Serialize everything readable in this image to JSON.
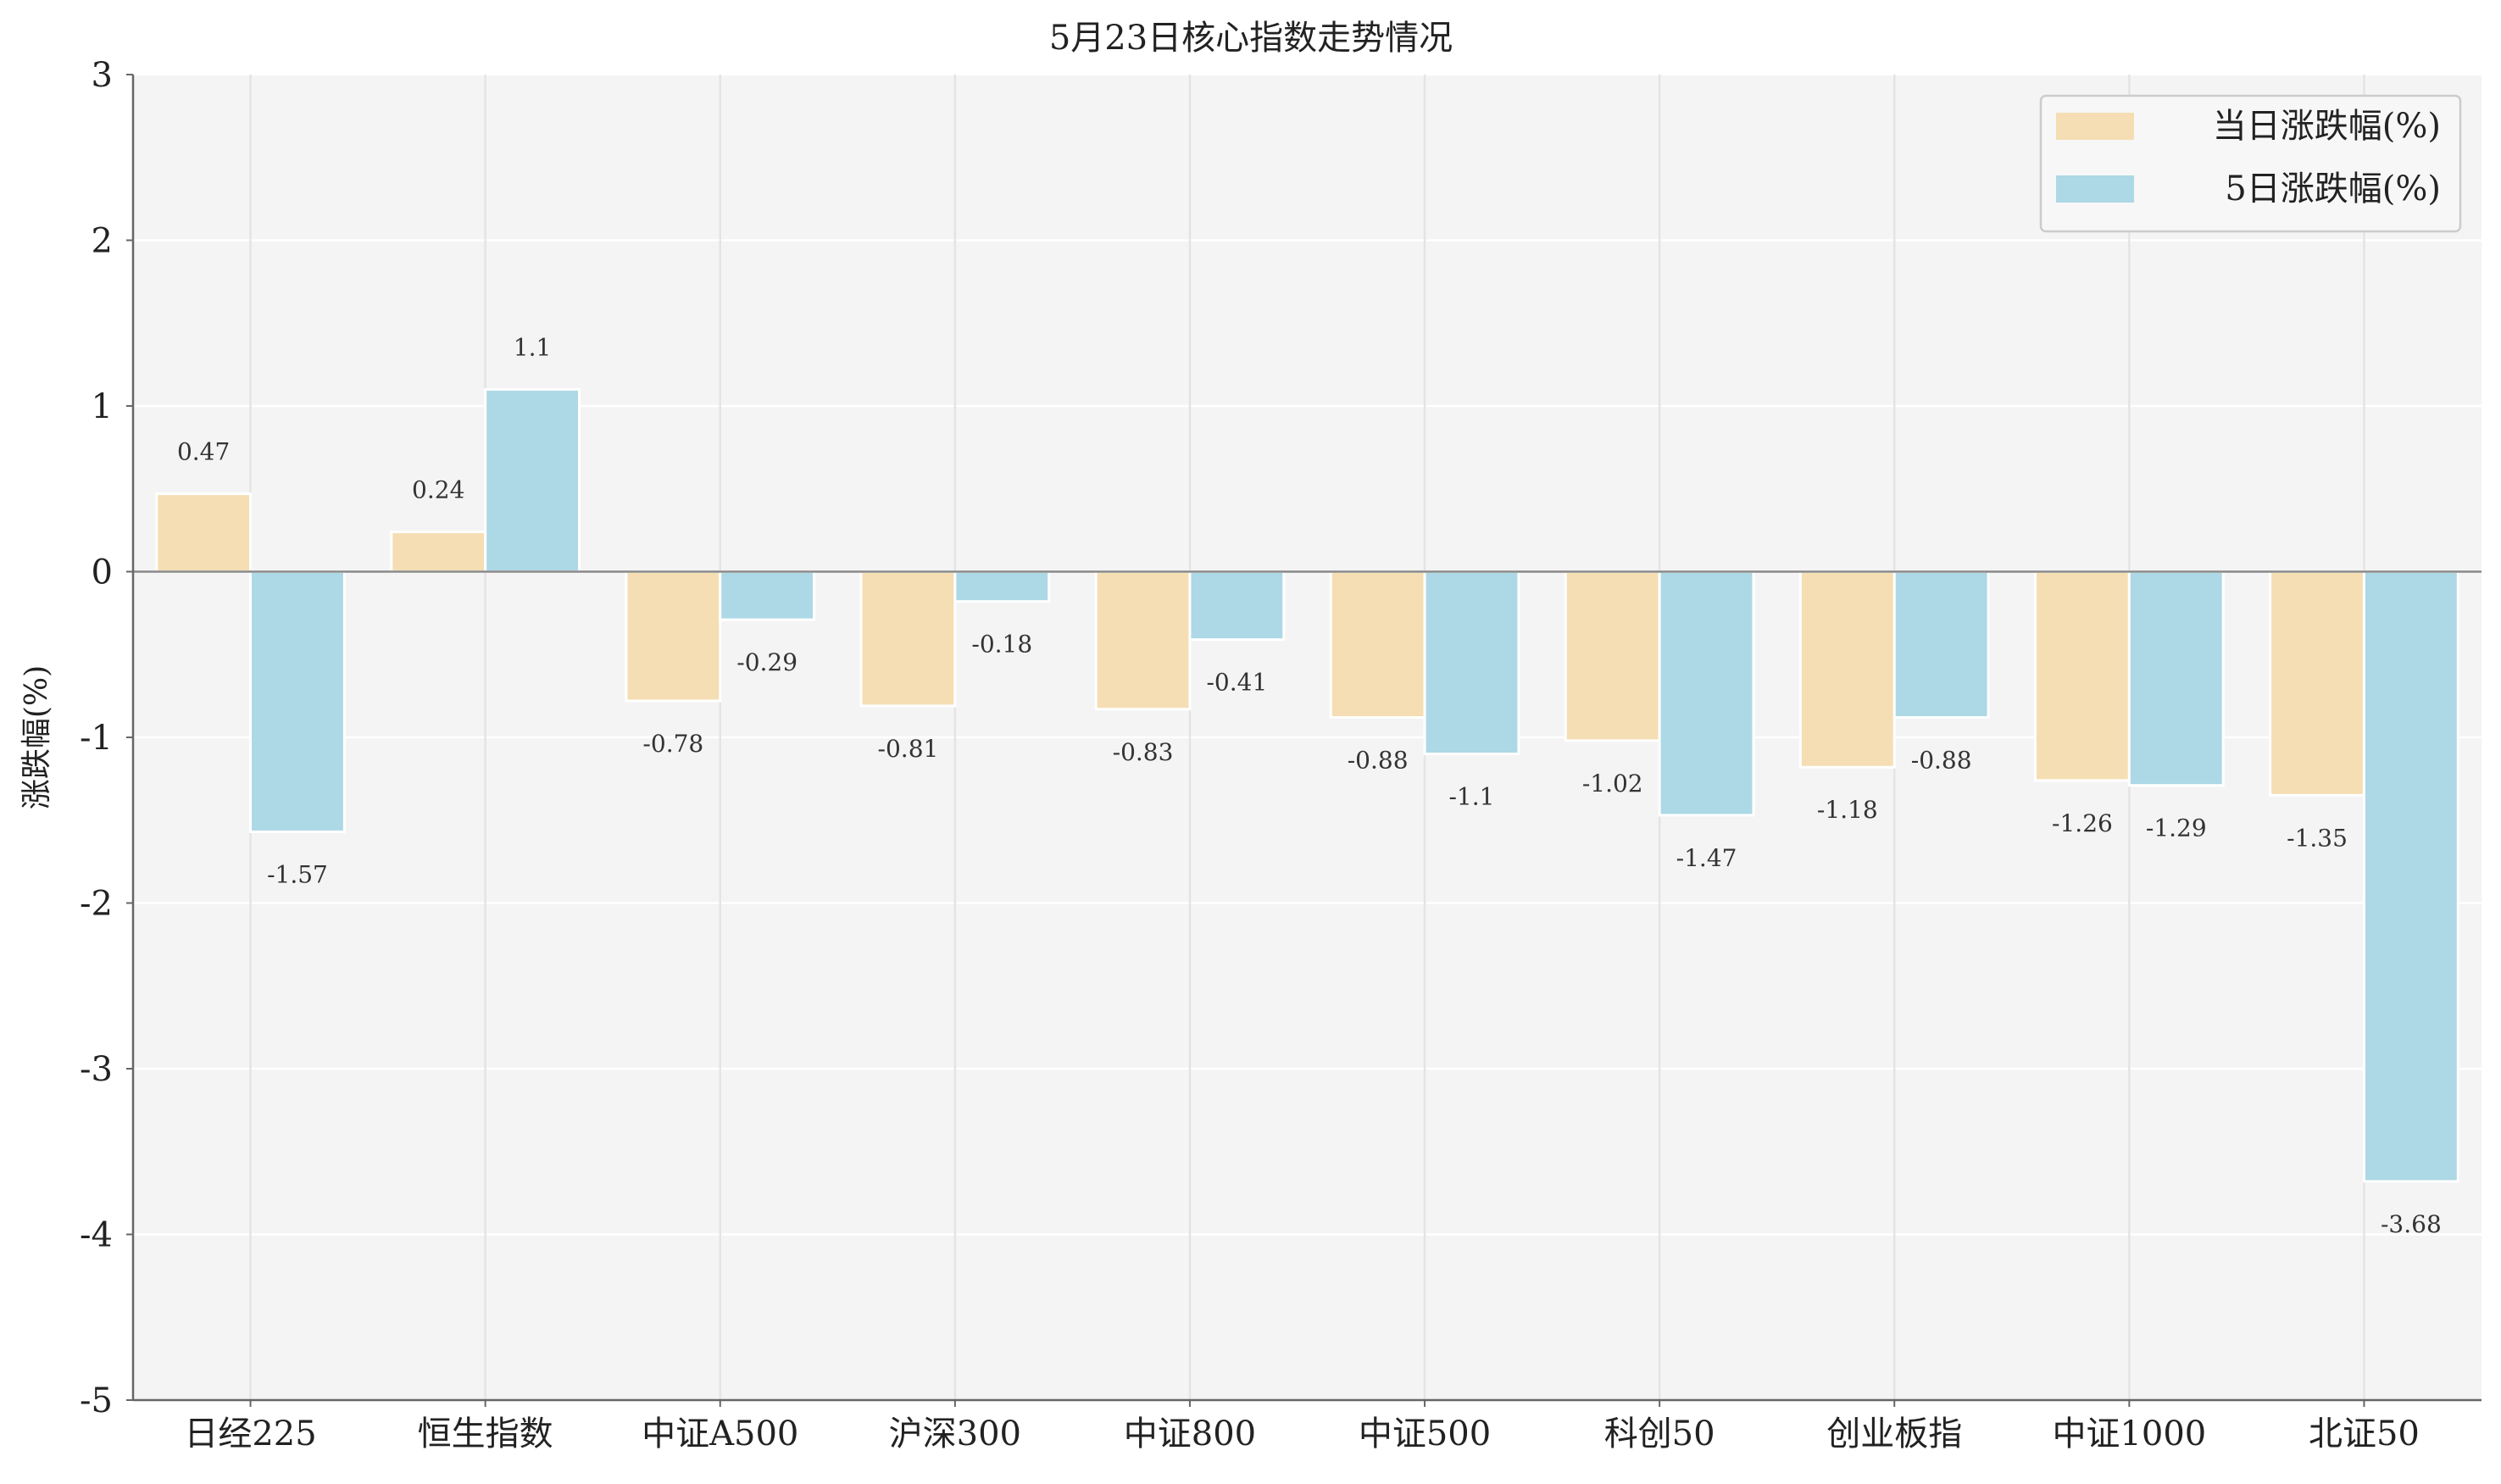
{
  "chart_data": {
    "type": "bar",
    "title": "5月23日核心指数走势情况",
    "xlabel": "",
    "ylabel": "涨跌幅(%)",
    "ylim": [
      -5,
      3
    ],
    "yticks": [
      "3",
      "2",
      "1",
      "0",
      "-1",
      "-2",
      "-3",
      "-4",
      "-5"
    ],
    "grid": true,
    "legend_position": "top-right",
    "categories": [
      "日经225",
      "恒生指数",
      "中证A500",
      "沪深300",
      "中证800",
      "中证500",
      "科创50",
      "创业板指",
      "中证1000",
      "北证50"
    ],
    "series": [
      {
        "name": "当日涨跌幅(%)",
        "color": "#f5deb3",
        "values": [
          0.47,
          0.24,
          -0.78,
          -0.81,
          -0.83,
          -0.88,
          -1.02,
          -1.18,
          -1.26,
          -1.35
        ],
        "labels": [
          "0.47",
          "0.24",
          "-0.78",
          "-0.81",
          "-0.83",
          "-0.88",
          "-1.02",
          "-1.18",
          "-1.26",
          "-1.35"
        ]
      },
      {
        "name": "5日涨跌幅(%)",
        "color": "#add8e6",
        "values": [
          -1.57,
          1.1,
          -0.29,
          -0.18,
          -0.41,
          -1.1,
          -1.47,
          -0.88,
          -1.29,
          -3.68
        ],
        "labels": [
          "-1.57",
          "1.1",
          "-0.29",
          "-0.18",
          "-0.41",
          "-1.1",
          "-1.47",
          "-0.88",
          "-1.29",
          "-3.68"
        ]
      }
    ]
  }
}
